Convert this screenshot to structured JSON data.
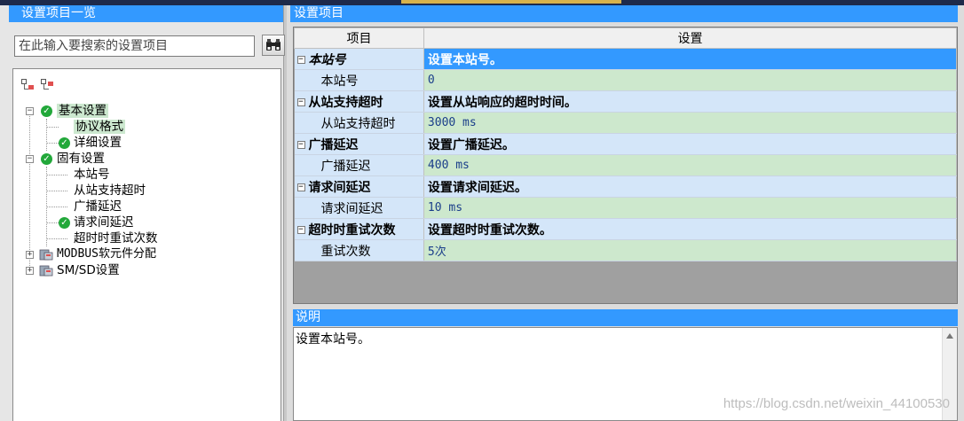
{
  "left": {
    "title": "设置项目一览",
    "search_placeholder": "在此输入要搜索的设置项目",
    "search_button_icon": "binoculars-icon",
    "toolbar_icons": [
      "expand-tree-icon",
      "collapse-tree-icon"
    ],
    "tree": {
      "basic": {
        "label": "基本设置",
        "children": [
          "协议格式",
          "详细设置"
        ]
      },
      "fixed": {
        "label": "固有设置",
        "children": [
          "本站号",
          "从站支持超时",
          "广播延迟",
          "请求间延迟",
          "超时时重试次数"
        ]
      },
      "modbus": {
        "label": "MODBUS软元件分配"
      },
      "smsd": {
        "label": "SM/SD设置"
      }
    }
  },
  "right": {
    "title": "设置项目",
    "columns": [
      "项目",
      "设置"
    ],
    "rows": [
      {
        "category": "本站号",
        "desc": "设置本站号。",
        "item": "本站号",
        "value": "0"
      },
      {
        "category": "从站支持超时",
        "desc": "设置从站响应的超时时间。",
        "item": "从站支持超时",
        "value": "3000 ms"
      },
      {
        "category": "广播延迟",
        "desc": "设置广播延迟。",
        "item": "广播延迟",
        "value": "400 ms"
      },
      {
        "category": "请求间延迟",
        "desc": "设置请求间延迟。",
        "item": "请求间延迟",
        "value": "10 ms"
      },
      {
        "category": "超时时重试次数",
        "desc": "设置超时时重试次数。",
        "item": "重试次数",
        "value": "5次"
      }
    ],
    "description": {
      "title": "说明",
      "text": "设置本站号。"
    }
  },
  "watermark": "https://blog.csdn.net/weixin_44100530",
  "colors": {
    "title_bar": "#3399ff",
    "category_row": "#d4e6f9",
    "value_cell": "#cde8cd",
    "check": "#22a83a"
  }
}
